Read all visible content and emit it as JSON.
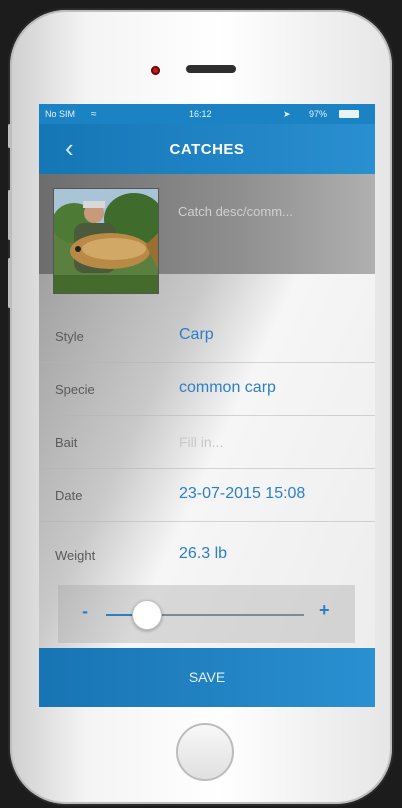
{
  "status_bar": {
    "carrier": "No SIM",
    "time": "16:12",
    "battery": "97%"
  },
  "nav": {
    "title": "CATCHES"
  },
  "catch": {
    "name_placeholder": "Catch desc/comm..."
  },
  "fields": [
    {
      "label": "Style",
      "value": "Carp",
      "is_placeholder": false
    },
    {
      "label": "Specie",
      "value": "common carp",
      "is_placeholder": false
    },
    {
      "label": "Bait",
      "value": "Fill in...",
      "is_placeholder": true
    },
    {
      "label": "Date",
      "value": "23-07-2015 15:08",
      "is_placeholder": false
    },
    {
      "label": "Weight",
      "value": "26.3 lb",
      "is_placeholder": false
    }
  ],
  "slider": {
    "minus_label": "-",
    "plus_label": "+",
    "level_fraction": 0.2
  },
  "save_label": "SAVE",
  "colors": {
    "accent": "#2c7fc7",
    "bar": "#1b83c4"
  }
}
